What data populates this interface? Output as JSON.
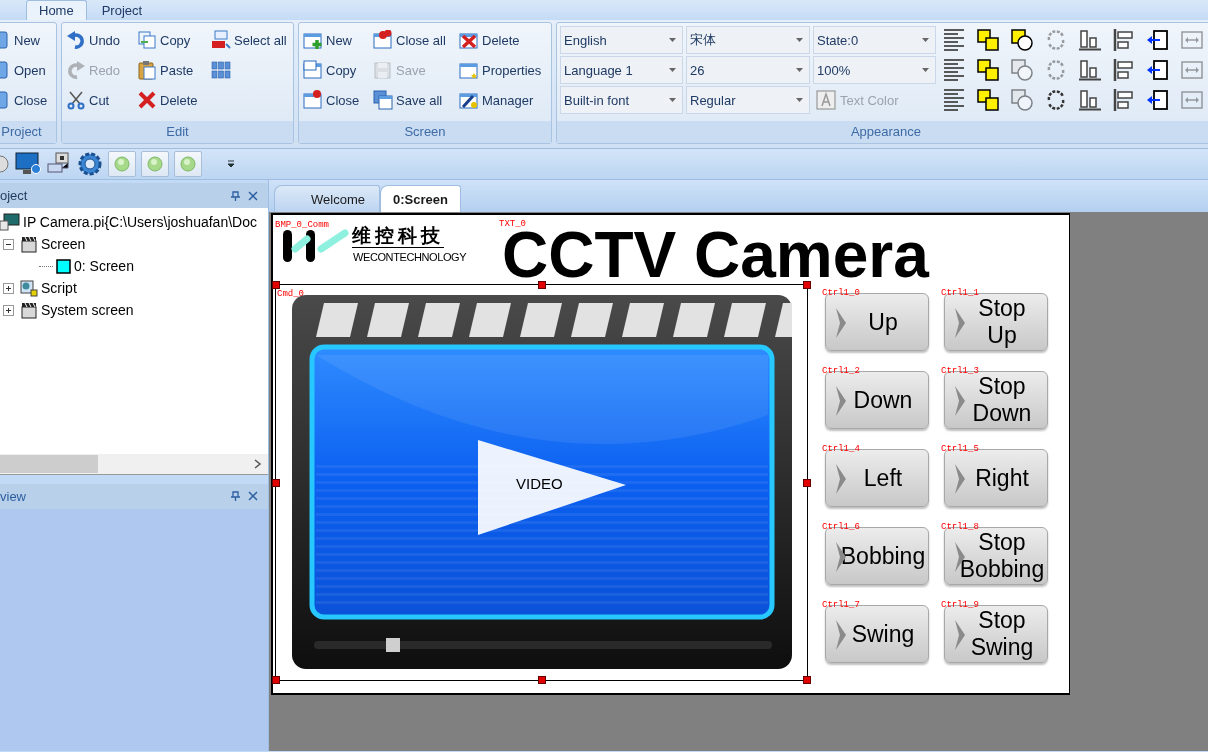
{
  "ribbon_tabs": [
    {
      "label": "Home",
      "selected": true
    },
    {
      "label": "Project",
      "selected": false
    }
  ],
  "ribbon_groups": [
    {
      "title": "Project",
      "buttons": [
        {
          "label": "New",
          "disabled": false
        },
        {
          "label": "Open",
          "disabled": false
        },
        {
          "label": "Close",
          "disabled": false
        }
      ]
    },
    {
      "title": "Edit",
      "buttons": [
        {
          "label": "Undo",
          "disabled": false
        },
        {
          "label": "Redo",
          "disabled": true
        },
        {
          "label": "Cut",
          "disabled": false
        },
        {
          "label": "Copy",
          "disabled": false
        },
        {
          "label": "Paste",
          "disabled": false
        },
        {
          "label": "Delete",
          "disabled": false
        },
        {
          "label": "Select all",
          "disabled": false
        },
        {
          "disabled": false
        }
      ]
    },
    {
      "title": "Screen",
      "buttons": [
        {
          "label": "New",
          "disabled": false
        },
        {
          "label": "Copy",
          "disabled": false
        },
        {
          "label": "Close",
          "disabled": false
        },
        {
          "label": "Close all",
          "disabled": false
        },
        {
          "label": "Save",
          "disabled": true
        },
        {
          "label": "Save all",
          "disabled": false
        },
        {
          "label": "Delete",
          "disabled": false
        },
        {
          "label": "Properties",
          "disabled": false
        },
        {
          "label": "Manager",
          "disabled": false
        }
      ]
    }
  ],
  "appearance": {
    "title": "Appearance",
    "dropdowns": [
      {
        "value": "English"
      },
      {
        "value": "Language 1"
      },
      {
        "value": "Built-in font"
      },
      {
        "value": "宋体"
      },
      {
        "value": "26"
      },
      {
        "value": "Regular"
      },
      {
        "value": "State:0"
      },
      {
        "value": "100%"
      }
    ],
    "text_color_button": {
      "label": "Text Color",
      "disabled": true
    },
    "tools": [
      {
        "disabled": false
      },
      {
        "disabled": false
      },
      {
        "disabled": false
      },
      {
        "disabled": true
      },
      {
        "disabled": false
      },
      {
        "disabled": false
      },
      {
        "disabled": false
      },
      {
        "disabled": true
      },
      {
        "disabled": false
      },
      {
        "disabled": false
      },
      {
        "disabled": true
      },
      {
        "disabled": true
      },
      {
        "disabled": false
      },
      {
        "disabled": false
      },
      {
        "disabled": false
      },
      {
        "disabled": true
      },
      {
        "disabled": false
      },
      {
        "disabled": false
      },
      {
        "disabled": true
      },
      {
        "disabled": false
      },
      {
        "disabled": false
      },
      {
        "disabled": false
      },
      {
        "disabled": false
      },
      {
        "disabled": true
      }
    ]
  },
  "project_panel": {
    "title": "oject",
    "tree": [
      {
        "label": "IP Camera.pi{C:\\Users\\joshuafan\\Doc",
        "children": [
          {
            "label": "Screen",
            "expanded": true,
            "children": [
              {
                "label": "0: Screen"
              }
            ]
          },
          {
            "label": "Script",
            "expanded": false
          },
          {
            "label": "System screen",
            "expanded": false
          }
        ]
      }
    ]
  },
  "preview_panel": {
    "title": "view"
  },
  "document_tabs": [
    {
      "label": "Welcome",
      "selected": false
    },
    {
      "label": "0:Screen",
      "selected": true
    }
  ],
  "hmi_screen": {
    "logo": {
      "tag": "BMP_0_Comm",
      "chinese": "维控科技",
      "english": "WECONTECHNOLOGY"
    },
    "title": {
      "tag": "TXT_0",
      "text": "CCTV Camera"
    },
    "video": {
      "tag": "Cmd_0",
      "label": "VIDEO",
      "selected": true
    },
    "buttons": [
      {
        "tag": "Ctrl1_0",
        "lines": [
          "Up"
        ]
      },
      {
        "tag": "Ctrl1_1",
        "lines": [
          "Stop",
          "Up"
        ]
      },
      {
        "tag": "Ctrl1_2",
        "lines": [
          "Down"
        ]
      },
      {
        "tag": "Ctrl1_3",
        "lines": [
          "Stop",
          "Down"
        ]
      },
      {
        "tag": "Ctrl1_4",
        "lines": [
          "Left"
        ]
      },
      {
        "tag": "Ctrl1_5",
        "lines": [
          "Right"
        ]
      },
      {
        "tag": "Ctrl1_6",
        "lines": [
          "Bobbing"
        ]
      },
      {
        "tag": "Ctrl1_8",
        "lines": [
          "Stop",
          "Bobbing"
        ]
      },
      {
        "tag": "Ctrl1_7",
        "lines": [
          "Swing"
        ]
      },
      {
        "tag": "Ctrl1_9",
        "lines": [
          "Stop",
          "Swing"
        ]
      }
    ]
  }
}
